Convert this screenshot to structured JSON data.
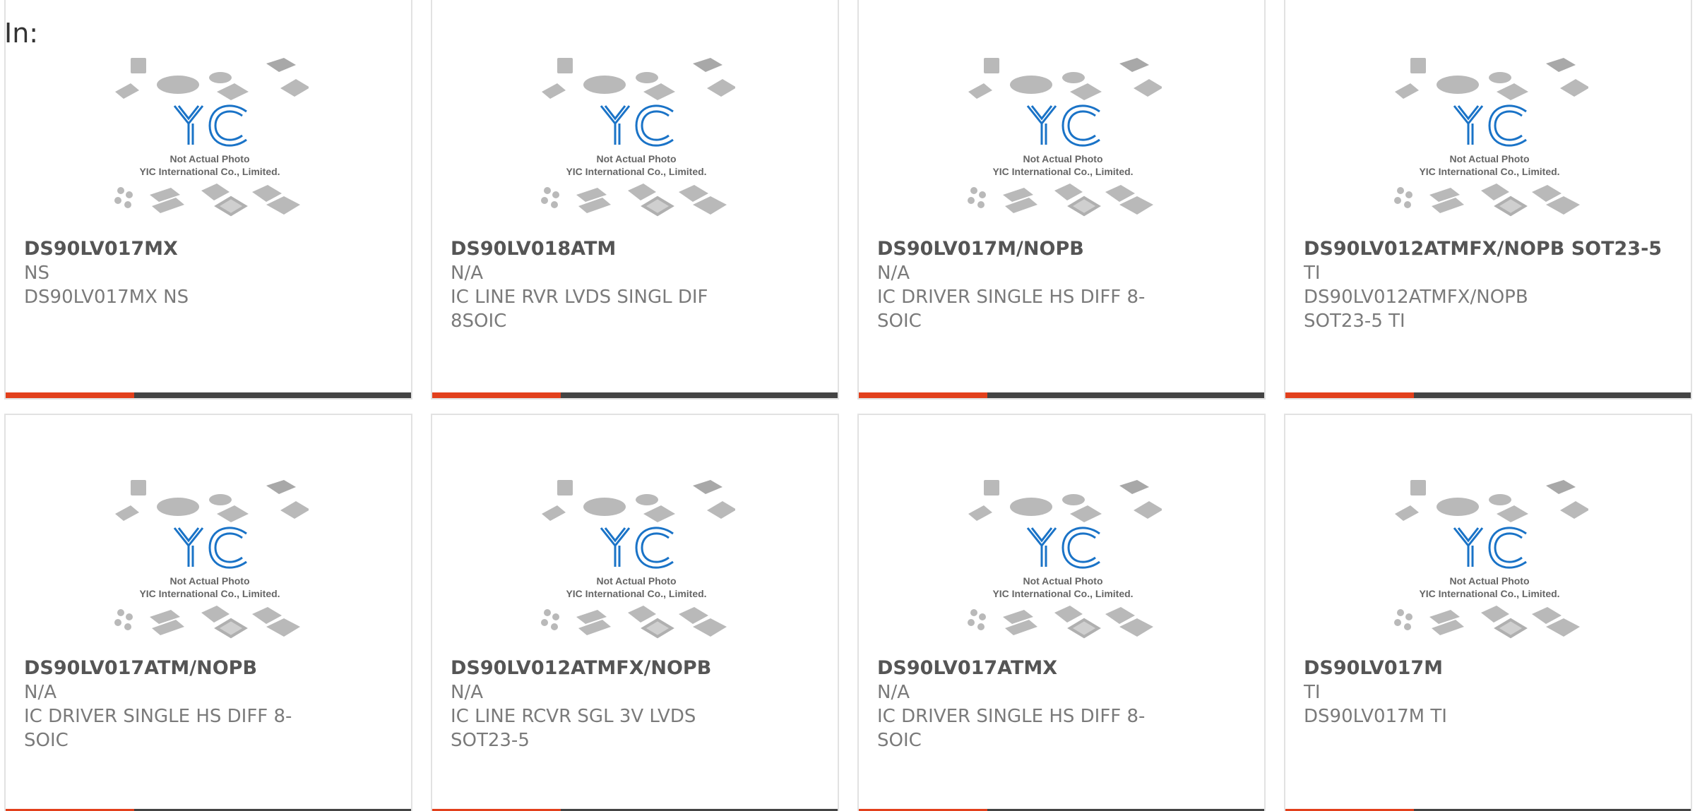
{
  "header": {
    "label": "In:"
  },
  "placeholder": {
    "line1": "Not Actual Photo",
    "line2": "YIC International Co., Limited.",
    "logo": "YIC"
  },
  "colors": {
    "accent": "#e2401c",
    "bar": "#444444",
    "logo_blue": "#1a73c7"
  },
  "products": [
    {
      "name": "DS90LV017MX",
      "manufacturer": "NS",
      "description": "DS90LV017MX NS"
    },
    {
      "name": "DS90LV018ATM",
      "manufacturer": "N/A",
      "description": "IC LINE RVR LVDS SINGL DIF 8SOIC"
    },
    {
      "name": "DS90LV017M/NOPB",
      "manufacturer": "N/A",
      "description": "IC DRIVER SINGLE HS DIFF 8-SOIC"
    },
    {
      "name": "DS90LV012ATMFX/NOPB SOT23-5",
      "manufacturer": "TI",
      "description": "DS90LV012ATMFX/NOPB SOT23-5 TI"
    },
    {
      "name": "DS90LV017ATM/NOPB",
      "manufacturer": "N/A",
      "description": "IC DRIVER SINGLE HS DIFF 8-SOIC"
    },
    {
      "name": "DS90LV012ATMFX/NOPB",
      "manufacturer": "N/A",
      "description": "IC LINE RCVR SGL 3V LVDS SOT23-5"
    },
    {
      "name": "DS90LV017ATMX",
      "manufacturer": "N/A",
      "description": "IC DRIVER SINGLE HS DIFF 8-SOIC"
    },
    {
      "name": "DS90LV017M",
      "manufacturer": "TI",
      "description": "DS90LV017M TI"
    }
  ]
}
